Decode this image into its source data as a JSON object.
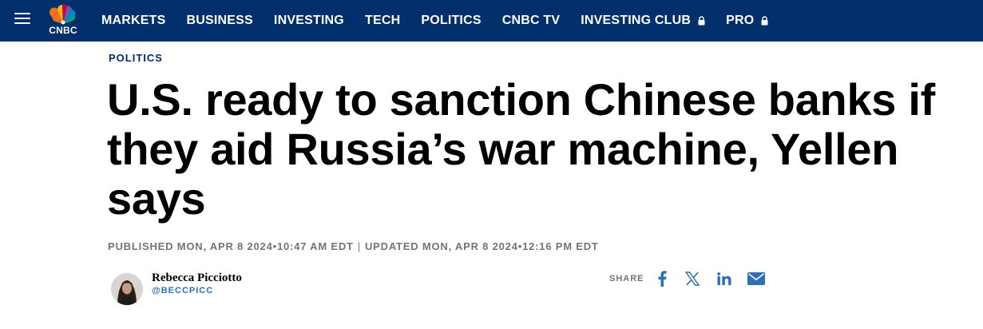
{
  "nav": {
    "menu_icon": "hamburger-menu-icon",
    "logo_text": "CNBC",
    "items": [
      {
        "label": "MARKETS"
      },
      {
        "label": "BUSINESS"
      },
      {
        "label": "INVESTING"
      },
      {
        "label": "TECH"
      },
      {
        "label": "POLITICS"
      },
      {
        "label": "CNBC TV"
      },
      {
        "label": "INVESTING CLUB",
        "icon": "lock-icon"
      },
      {
        "label": "PRO",
        "icon": "lock-icon"
      }
    ],
    "background_color": "#002f6c"
  },
  "article": {
    "section": "POLITICS",
    "headline": "U.S. ready to sanction Chinese banks if they aid Russia’s war machine, Yellen says",
    "published": "PUBLISHED MON, APR 8 2024•10:47 AM EDT",
    "separator": "|",
    "updated": "UPDATED MON, APR 8 2024•12:16 PM EDT"
  },
  "author": {
    "name": "Rebecca Picciotto",
    "handle": "@BECCPICC",
    "avatar_icon": "author-avatar"
  },
  "share": {
    "label": "SHARE",
    "icons": [
      "facebook-icon",
      "x-twitter-icon",
      "linkedin-icon",
      "email-icon"
    ],
    "icon_color": "#2f6fb5"
  }
}
